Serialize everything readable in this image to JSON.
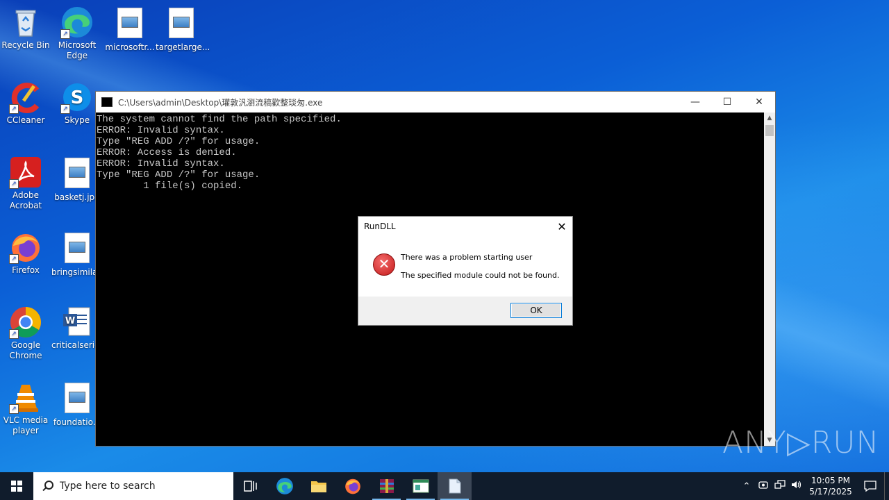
{
  "desktop": {
    "icons": [
      {
        "label": "Recycle Bin",
        "icon": "recycle-bin-icon"
      },
      {
        "label": "Microsoft Edge",
        "icon": "edge-icon"
      },
      {
        "label": "microsoftr...",
        "icon": "image-file-icon"
      },
      {
        "label": "targetlarge...",
        "icon": "image-file-icon"
      },
      {
        "label": "CCleaner",
        "icon": "ccleaner-icon"
      },
      {
        "label": "Skype",
        "icon": "skype-icon"
      },
      {
        "label": "Adobe Acrobat",
        "icon": "acrobat-icon"
      },
      {
        "label": "basketj.jpg",
        "icon": "image-file-icon"
      },
      {
        "label": "Firefox",
        "icon": "firefox-icon"
      },
      {
        "label": "bringsimila...",
        "icon": "image-file-icon"
      },
      {
        "label": "Google Chrome",
        "icon": "chrome-icon"
      },
      {
        "label": "criticalserie...",
        "icon": "word-doc-icon"
      },
      {
        "label": "VLC media player",
        "icon": "vlc-icon"
      },
      {
        "label": "foundatio...",
        "icon": "image-file-icon"
      }
    ]
  },
  "console": {
    "title": "C:\\Users\\admin\\Desktop\\瓘敦汎瀏流稿歡整琰匆.exe",
    "minimize": "—",
    "maximize": "☐",
    "close": "✕",
    "lines": [
      "The system cannot find the path specified.",
      "ERROR: Invalid syntax.",
      "Type \"REG ADD /?\" for usage.",
      "ERROR: Access is denied.",
      "ERROR: Invalid syntax.",
      "Type \"REG ADD /?\" for usage.",
      "        1 file(s) copied."
    ]
  },
  "dialog": {
    "title": "RunDLL",
    "close": "✕",
    "message1": "There was a problem starting user",
    "message2": "The specified module could not be found.",
    "ok_label": "OK",
    "error_glyph": "✕"
  },
  "watermark": "ANY▷RUN",
  "taskbar": {
    "search_placeholder": "Type here to search",
    "time": "10:05 PM",
    "date": "5/17/2025"
  }
}
